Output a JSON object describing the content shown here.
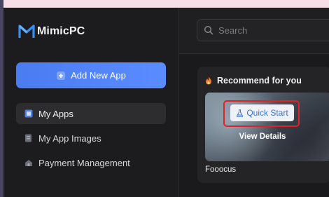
{
  "brand": {
    "name": "MimicPC"
  },
  "sidebar": {
    "add_button_label": "Add New App",
    "items": [
      {
        "label": "My Apps",
        "icon": "apps-icon",
        "active": true
      },
      {
        "label": "My App Images",
        "icon": "app-images-icon",
        "active": false
      },
      {
        "label": "Payment Management",
        "icon": "payment-icon",
        "active": false
      }
    ]
  },
  "search": {
    "placeholder": "Search"
  },
  "recommend": {
    "title": "Recommend for you",
    "quick_start_label": "Quick Start",
    "view_details_label": "View Details",
    "app_name": "Fooocus"
  },
  "colors": {
    "accent": "#4a7cf0",
    "highlight": "#e0202a",
    "top_strip": "#f6dfe6"
  }
}
